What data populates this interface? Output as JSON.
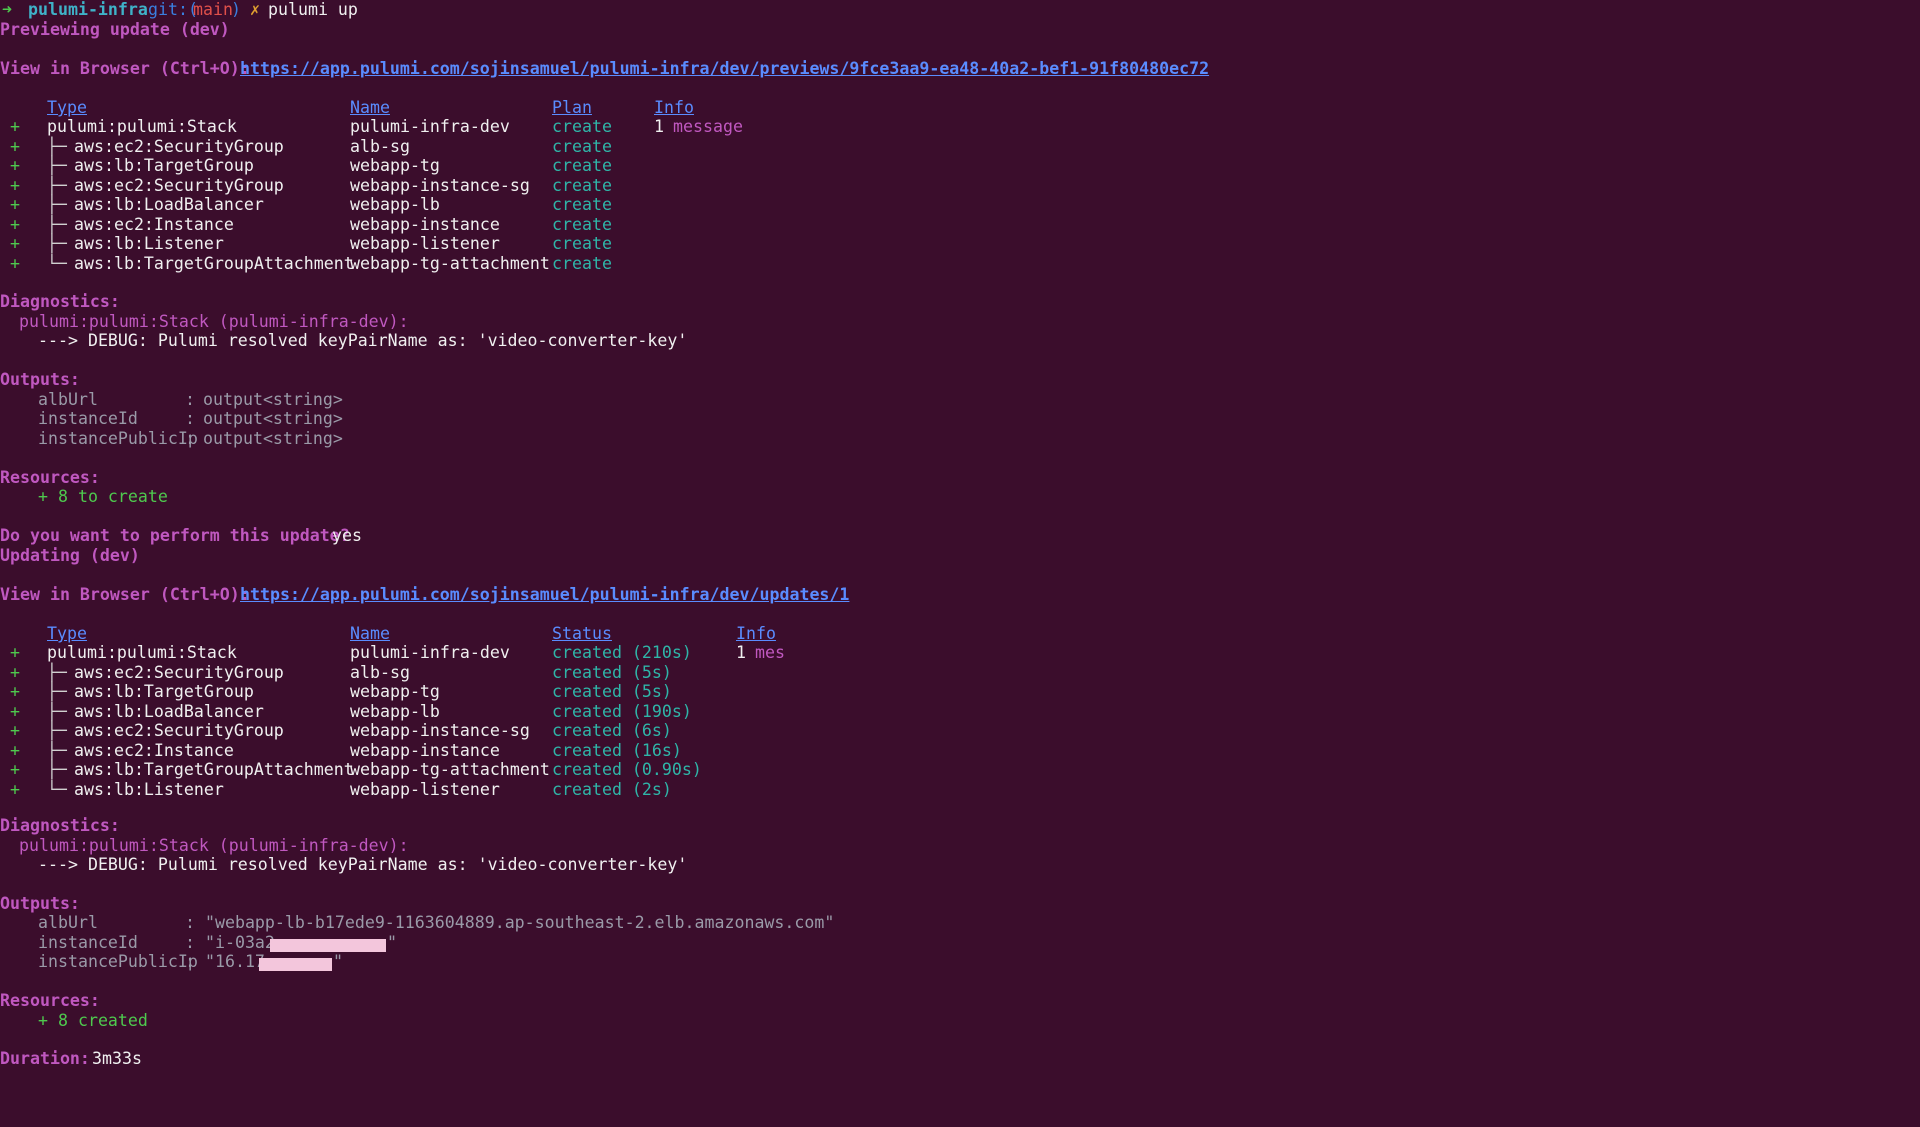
{
  "prompt": {
    "arrow": "➜",
    "dir": "pulumi-infra",
    "git_prefix": "git:(",
    "branch": "main",
    "git_suffix": ")",
    "dirty_mark": "✗",
    "command": "pulumi up"
  },
  "preview": {
    "title": "Previewing update (dev)",
    "browser_label": "View in Browser (Ctrl+O):",
    "browser_url": "https://app.pulumi.com/sojinsamuel/pulumi-infra/dev/previews/9fce3aa9-ea48-40a2-bef1-91f80480ec72",
    "headers": {
      "type": "Type",
      "name": "Name",
      "plan": "Plan",
      "info": "Info"
    },
    "rows": [
      {
        "op": "+",
        "tree": "",
        "type": "pulumi:pulumi:Stack",
        "name": "pulumi-infra-dev",
        "plan": "create",
        "info_count": "1",
        "info_text": "message"
      },
      {
        "op": "+",
        "tree": "├─",
        "type": "aws:ec2:SecurityGroup",
        "name": "alb-sg",
        "plan": "create"
      },
      {
        "op": "+",
        "tree": "├─",
        "type": "aws:lb:TargetGroup",
        "name": "webapp-tg",
        "plan": "create"
      },
      {
        "op": "+",
        "tree": "├─",
        "type": "aws:ec2:SecurityGroup",
        "name": "webapp-instance-sg",
        "plan": "create"
      },
      {
        "op": "+",
        "tree": "├─",
        "type": "aws:lb:LoadBalancer",
        "name": "webapp-lb",
        "plan": "create"
      },
      {
        "op": "+",
        "tree": "├─",
        "type": "aws:ec2:Instance",
        "name": "webapp-instance",
        "plan": "create"
      },
      {
        "op": "+",
        "tree": "├─",
        "type": "aws:lb:Listener",
        "name": "webapp-listener",
        "plan": "create"
      },
      {
        "op": "+",
        "tree": "└─",
        "type": "aws:lb:TargetGroupAttachment",
        "name": "webapp-tg-attachment",
        "plan": "create"
      }
    ],
    "diagnostics_label": "Diagnostics:",
    "diag_source": "pulumi:pulumi:Stack (pulumi-infra-dev):",
    "diag_message": "---> DEBUG: Pulumi resolved keyPairName as: 'video-converter-key'",
    "outputs_label": "Outputs:",
    "outputs": [
      {
        "key": "albUrl          ",
        "sep": ": ",
        "value": "output<string>"
      },
      {
        "key": "instanceId      ",
        "sep": ": ",
        "value": "output<string>"
      },
      {
        "key": "instancePublicIp",
        "sep": ": ",
        "value": "output<string>"
      }
    ],
    "resources_label": "Resources:",
    "resources_summary": "+ 8 to create"
  },
  "confirm": {
    "question": "Do you want to perform this update?",
    "answer": "yes"
  },
  "update": {
    "title": "Updating (dev)",
    "browser_label": "View in Browser (Ctrl+O):",
    "browser_url": "https://app.pulumi.com/sojinsamuel/pulumi-infra/dev/updates/1",
    "headers": {
      "type": "Type",
      "name": "Name",
      "status": "Status",
      "info": "Info"
    },
    "rows": [
      {
        "op": "+",
        "tree": "",
        "type": "pulumi:pulumi:Stack",
        "name": "pulumi-infra-dev",
        "status": "created (210s)",
        "info_count": "1",
        "info_text": "mes"
      },
      {
        "op": "+",
        "tree": "├─",
        "type": "aws:ec2:SecurityGroup",
        "name": "alb-sg",
        "status": "created (5s)"
      },
      {
        "op": "+",
        "tree": "├─",
        "type": "aws:lb:TargetGroup",
        "name": "webapp-tg",
        "status": "created (5s)"
      },
      {
        "op": "+",
        "tree": "├─",
        "type": "aws:lb:LoadBalancer",
        "name": "webapp-lb",
        "status": "created (190s)"
      },
      {
        "op": "+",
        "tree": "├─",
        "type": "aws:ec2:SecurityGroup",
        "name": "webapp-instance-sg",
        "status": "created (6s)"
      },
      {
        "op": "+",
        "tree": "├─",
        "type": "aws:ec2:Instance",
        "name": "webapp-instance",
        "status": "created (16s)"
      },
      {
        "op": "+",
        "tree": "├─",
        "type": "aws:lb:TargetGroupAttachment",
        "name": "webapp-tg-attachment",
        "status": "created (0.90s)"
      },
      {
        "op": "+",
        "tree": "└─",
        "type": "aws:lb:Listener",
        "name": "webapp-listener",
        "status": "created (2s)"
      }
    ],
    "diagnostics_label": "Diagnostics:",
    "diag_source": "pulumi:pulumi:Stack (pulumi-infra-dev):",
    "diag_message": "---> DEBUG: Pulumi resolved keyPairName as: 'video-converter-key'",
    "outputs_label": "Outputs:",
    "out_alb_key": "albUrl          ",
    "out_alb_value": ": \"webapp-lb-b17ede9-1163604889.ap-southeast-2.elb.amazonaws.com\"",
    "out_id_key": "instanceId      ",
    "out_id_value": ": \"i-03a2",
    "out_id_end": "\"",
    "out_ip_key": "instancePublicIp",
    "out_ip_value": ": \"16.17",
    "out_ip_end": "\"",
    "resources_label": "Resources:",
    "resources_summary": "+ 8 created",
    "duration_label": "Duration:",
    "duration_value": "3m33s"
  },
  "colors": {
    "background": "#3b0d2c",
    "op_plus": "#4ec94e",
    "section_label": "#c058c0",
    "link": "#5a8cff",
    "plan": "#2fb5a8",
    "redaction": "#f3c6dc"
  }
}
